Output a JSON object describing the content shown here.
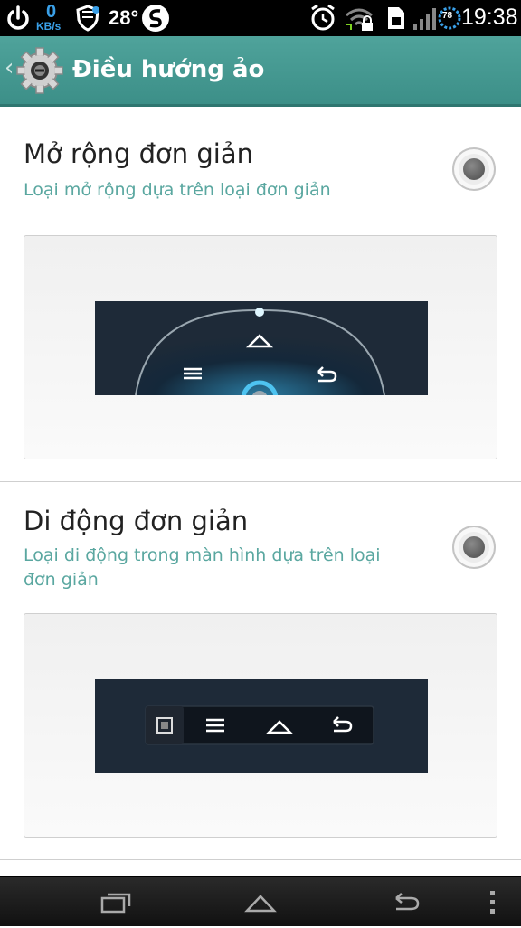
{
  "status_bar": {
    "speed_value": "0",
    "speed_unit": "KB/s",
    "temperature": "28°",
    "battery_level": "78",
    "time": "19:38",
    "icons": [
      "power-icon",
      "shield-icon",
      "s-logo-icon",
      "alarm-icon",
      "wifi-icon",
      "sim-icon",
      "signal-icon",
      "battery-icon"
    ]
  },
  "action_bar": {
    "title": "Điều hướng ảo",
    "icons": [
      "back-chevron-icon",
      "settings-gear-icon"
    ],
    "color": "#4a9d96"
  },
  "options": [
    {
      "title": "Mở rộng đơn giản",
      "subtitle": "Loại mở rộng dựa trên loại đơn giản",
      "selected": false
    },
    {
      "title": "Di động đơn giản",
      "subtitle_line1": "Loại di động trong màn hình dựa trên loại",
      "subtitle_line2": "đơn giản",
      "selected": false
    }
  ],
  "nav_bar": {
    "icons": [
      "recent-apps-icon",
      "home-icon",
      "back-icon",
      "menu-dots-icon"
    ]
  },
  "colors": {
    "accent": "#4a9d96",
    "subtitle": "#5aa7a0",
    "preview_bg": "#1e2a38"
  }
}
